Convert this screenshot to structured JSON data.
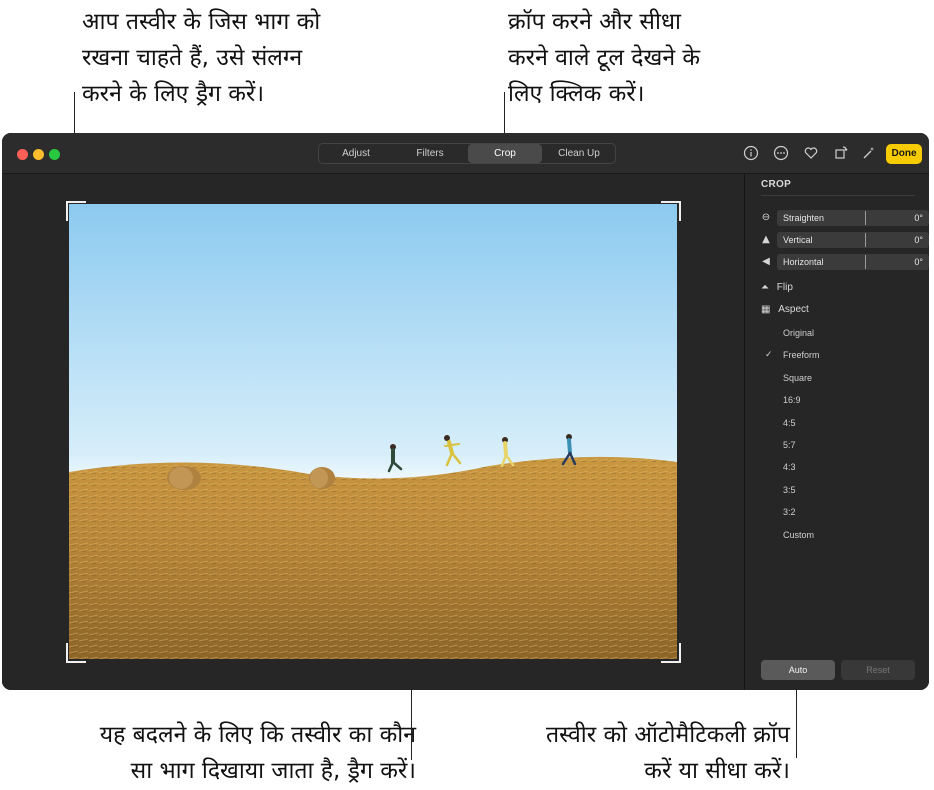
{
  "callouts": {
    "top_left": "आप तस्वीर के जिस भाग को\nरखना चाहते हैं, उसे संलग्न\nकरने के लिए ड्रैग करें।",
    "top_right": "क्रॉप करने और सीधा\nकरने वाले टूल देखने के\nलिए क्लिक करें।",
    "bottom_left": "यह बदलने के लिए कि तस्वीर का कौन\nसा भाग दिखाया जाता है, ड्रैग करें।",
    "bottom_right": "तस्वीर को ऑटोमैटिकली क्रॉप\nकरें या सीधा करें।"
  },
  "window": {
    "traffic_lights": [
      "#fe5f57",
      "#febc2e",
      "#28c840"
    ],
    "tabs": [
      {
        "label": "Adjust",
        "active": false
      },
      {
        "label": "Filters",
        "active": false
      },
      {
        "label": "Crop",
        "active": true
      },
      {
        "label": "Clean Up",
        "active": false
      }
    ],
    "toolbar_icons": [
      "info-icon",
      "more-icon",
      "heart-icon",
      "rotate-icon",
      "magic-wand-icon"
    ],
    "done_label": "Done",
    "accent": "#f6cc00"
  },
  "sidebar": {
    "title": "CROP",
    "sliders": [
      {
        "label": "Straighten",
        "value": "0°",
        "icon": "straighten-icon"
      },
      {
        "label": "Vertical",
        "value": "0°",
        "icon": "vertical-icon"
      },
      {
        "label": "Horizontal",
        "value": "0°",
        "icon": "horizontal-icon"
      }
    ],
    "flip_label": "Flip",
    "aspect_label": "Aspect",
    "aspect_options": [
      "Original",
      "Freeform",
      "Square",
      "16:9",
      "4:5",
      "5:7",
      "4:3",
      "3:5",
      "3:2",
      "Custom"
    ],
    "selected_aspect": "Freeform",
    "auto_label": "Auto",
    "reset_label": "Reset"
  }
}
